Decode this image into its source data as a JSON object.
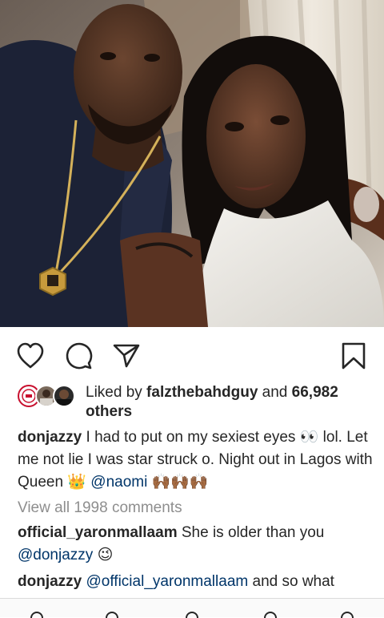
{
  "photo": {
    "alt": ""
  },
  "actions": {
    "like_icon": "heart-outline-icon",
    "comment_icon": "comment-bubble-icon",
    "share_icon": "paper-plane-icon",
    "save_icon": "bookmark-icon"
  },
  "likes": {
    "prefix": "Liked by ",
    "user": "falzthebahdguy",
    "middle": " and ",
    "count": "66,982",
    "others": "others"
  },
  "caption": {
    "user": "donjazzy",
    "text_1": " I had to put on my sexiest eyes ",
    "eyes_emoji": "👀",
    "text_2": " lol. Let me not lie I was star struck o. Night out in Lagos with  Queen ",
    "crown_emoji": "👑",
    "mention": "@naomi",
    "hands_emoji": "🙌🏾🙌🏾🙌🏾"
  },
  "view_all": "View all 1998 comments",
  "comments": [
    {
      "user": "official_yaronmallaam",
      "text": " She is older than you ",
      "mention": "@donjazzy",
      "emoji": "😉"
    },
    {
      "user": "donjazzy",
      "mention": "@official_yaronmallaam",
      "text": " and so what"
    }
  ],
  "colors": {
    "mention": "#003569",
    "muted": "#8e8e8e",
    "text": "#262626"
  }
}
